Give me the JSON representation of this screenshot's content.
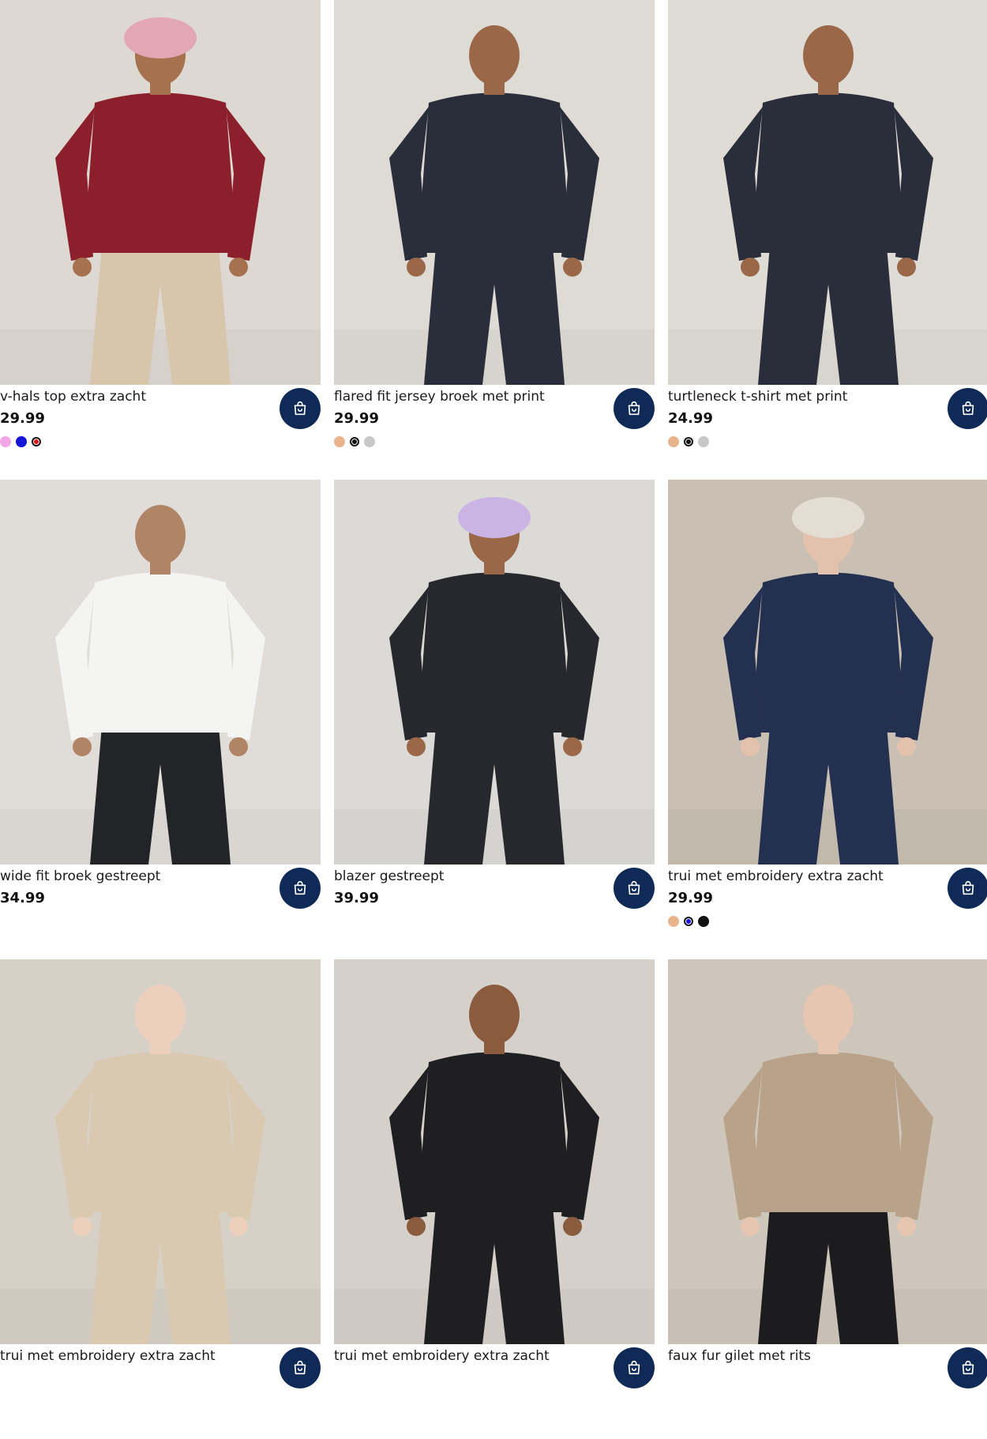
{
  "products": [
    {
      "name": "v-hals top extra zacht",
      "price": "29.99",
      "swatches": [
        {
          "color": "#f3a6e6",
          "selected": false
        },
        {
          "color": "#1515d6",
          "selected": false
        },
        {
          "color": "#e0141c",
          "selected": true
        }
      ],
      "photo": {
        "bg": "#ddd8d1",
        "garment": "#8c1f2c",
        "bottom": "#d8c6ac",
        "skin": "#a6714f",
        "cap": "#e2a6b5"
      }
    },
    {
      "name": "flared fit jersey broek met print",
      "price": "29.99",
      "swatches": [
        {
          "color": "#e8b48e",
          "selected": false
        },
        {
          "color": "#111111",
          "selected": true
        },
        {
          "color": "#c8c8c8",
          "selected": false
        }
      ],
      "photo": {
        "bg": "#dedad4",
        "garment": "#2a2e3b",
        "bottom": "#2a2e3b",
        "skin": "#9a6849",
        "cap": ""
      }
    },
    {
      "name": "turtleneck t-shirt met print",
      "price": "24.99",
      "swatches": [
        {
          "color": "#e8b48e",
          "selected": false
        },
        {
          "color": "#111111",
          "selected": true
        },
        {
          "color": "#c8c8c8",
          "selected": false
        }
      ],
      "photo": {
        "bg": "#dfdcd6",
        "garment": "#2a2e3b",
        "bottom": "#2a2e3b",
        "skin": "#9a6849",
        "cap": ""
      }
    },
    {
      "name": "wide fit broek gestreept",
      "price": "34.99",
      "swatches": [],
      "photo": {
        "bg": "#e0ddd8",
        "garment": "#f4f4f2",
        "bottom": "#222428",
        "skin": "#b08466",
        "cap": ""
      }
    },
    {
      "name": "blazer gestreept",
      "price": "39.99",
      "swatches": [],
      "photo": {
        "bg": "#dcdad6",
        "garment": "#26282d",
        "bottom": "#26282d",
        "skin": "#9a6849",
        "cap": "#c9b4e4"
      }
    },
    {
      "name": "trui met embroidery extra zacht",
      "price": "29.99",
      "swatches": [
        {
          "color": "#e8b48e",
          "selected": false
        },
        {
          "color": "#1515d6",
          "selected": true
        },
        {
          "color": "#111111",
          "selected": false
        }
      ],
      "photo": {
        "bg": "#c9bfb3",
        "garment": "#24304f",
        "bottom": "#24304f",
        "skin": "#e3c2ad",
        "cap": "#e3ddd2"
      }
    },
    {
      "name": "trui met embroidery extra zacht",
      "price": "",
      "swatches": [],
      "photo": {
        "bg": "#d6d0c6",
        "garment": "#d9c9b0",
        "bottom": "#d9c9b0",
        "skin": "#ecd0bd",
        "cap": ""
      }
    },
    {
      "name": "trui met embroidery extra zacht",
      "price": "",
      "swatches": [],
      "photo": {
        "bg": "#d5d0c9",
        "garment": "#1f1f22",
        "bottom": "#1f1f22",
        "skin": "#8a5b3e",
        "cap": ""
      }
    },
    {
      "name": "faux fur gilet met rits",
      "price": "",
      "swatches": [],
      "photo": {
        "bg": "#cfc6bb",
        "garment": "#b8a38a",
        "bottom": "#1c1c1e",
        "skin": "#e6c6b1",
        "cap": ""
      }
    }
  ],
  "icons": {
    "cart": "shopping-bag-icon"
  },
  "colors": {
    "cart_button": "#0f2a57"
  }
}
